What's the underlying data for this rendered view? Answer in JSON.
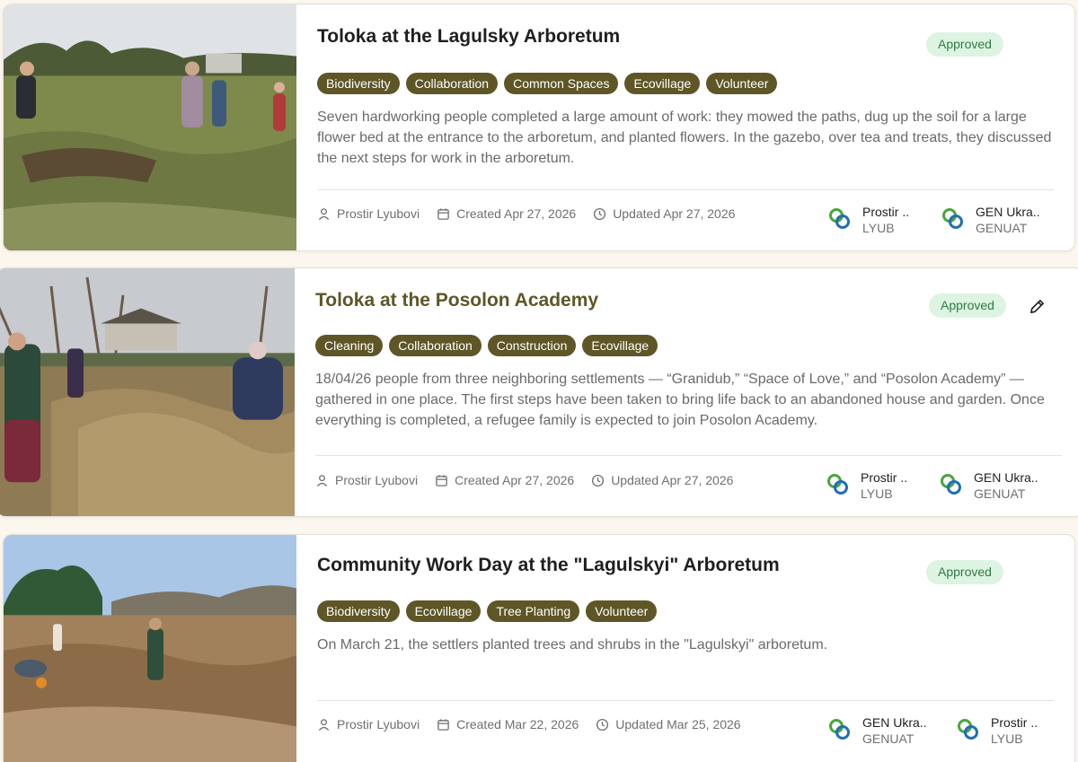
{
  "theme": {
    "accent": "#5e5626",
    "title_alt": "#5e5626",
    "approved_bg": "#dcf4e1",
    "approved_text": "#2f7a44"
  },
  "posts": [
    {
      "title": "Toloka at the Lagulsky Arboretum",
      "status": "Approved",
      "tags": [
        "Biodiversity",
        "Collaboration",
        "Common Spaces",
        "Ecovillage",
        "Volunteer"
      ],
      "description": "Seven hardworking people completed a large amount of work: they mowed the paths, dug up the soil for a large flower bed at the entrance to the arboretum, and planted flowers. In the gazebo, over tea and treats, they discussed the next steps for work in the arboretum.",
      "author": "Prostir Lyubovi",
      "created": "Created Apr 27, 2026",
      "updated": "Updated Apr 27, 2026",
      "orgs": [
        {
          "name": "Prostir ..",
          "code": "LYUB"
        },
        {
          "name": "GEN Ukra..",
          "code": "GENUAT"
        }
      ]
    },
    {
      "title": "Toloka at the Posolon Academy",
      "status": "Approved",
      "tags": [
        "Cleaning",
        "Collaboration",
        "Construction",
        "Ecovillage"
      ],
      "description": "18/04/26 people from three neighboring settlements — “Granidub,” “Space of Love,” and “Posolon Academy” — gathered in one place. The first steps have been taken to bring life back to an abandoned house and garden. Once everything is completed, a refugee family is expected to join Posolon Academy.",
      "author": "Prostir Lyubovi",
      "created": "Created Apr 27, 2026",
      "updated": "Updated Apr 27, 2026",
      "orgs": [
        {
          "name": "Prostir ..",
          "code": "LYUB"
        },
        {
          "name": "GEN Ukra..",
          "code": "GENUAT"
        }
      ]
    },
    {
      "title": "Community Work Day at the \"Lagulskyi\" Arboretum",
      "status": "Approved",
      "tags": [
        "Biodiversity",
        "Ecovillage",
        "Tree Planting",
        "Volunteer"
      ],
      "description": "On March 21, the settlers planted trees and shrubs in the \"Lagulskyi\" arboretum.",
      "author": "Prostir Lyubovi",
      "created": "Created Mar 22, 2026",
      "updated": "Updated Mar 25, 2026",
      "orgs": [
        {
          "name": "GEN Ukra..",
          "code": "GENUAT"
        },
        {
          "name": "Prostir ..",
          "code": "LYUB"
        }
      ]
    }
  ]
}
